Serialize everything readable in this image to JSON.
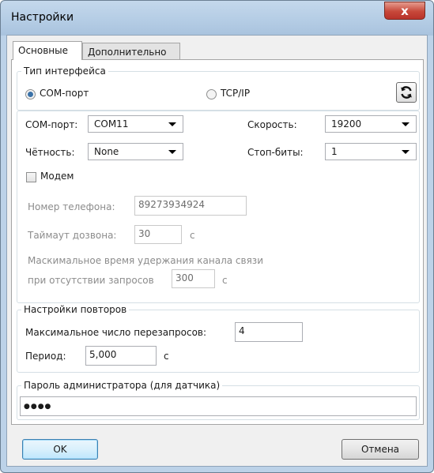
{
  "window": {
    "title": "Настройки",
    "close_glyph": "x"
  },
  "tabs": [
    {
      "label": "Основные"
    },
    {
      "label": "Дополнительно"
    }
  ],
  "interface_group": {
    "legend": "Тип интерфейса",
    "radio_com": "COM-порт",
    "radio_tcp": "TCP/IP",
    "selected": "COM-порт",
    "refresh_icon": "refresh-icon"
  },
  "com": {
    "port_label": "COM-порт:",
    "port_value": "COM11",
    "speed_label": "Скорость:",
    "speed_value": "19200",
    "parity_label": "Чётность:",
    "parity_value": "None",
    "stop_label": "Стоп-биты:",
    "stop_value": "1"
  },
  "modem": {
    "label": "Модем",
    "checked": false,
    "phone_label": "Номер телефона:",
    "phone_value": "89273934924",
    "timeout_label": "Таймаут дозвона:",
    "timeout_value": "30",
    "timeout_unit": "с",
    "hold_line1": "Маскимальное время удержания канала связи",
    "hold_line2": "при отсутствии запросов",
    "hold_value": "300",
    "hold_unit": "с"
  },
  "retry": {
    "legend": "Настройки повторов",
    "max_label": "Максимальное число перезапросов:",
    "max_value": "4",
    "period_label": "Период:",
    "period_value": "5,000",
    "period_unit": "с"
  },
  "password": {
    "legend": "Пароль администратора (для датчика)",
    "value": "●●●●"
  },
  "buttons": {
    "ok": "OK",
    "cancel": "Отмена"
  }
}
